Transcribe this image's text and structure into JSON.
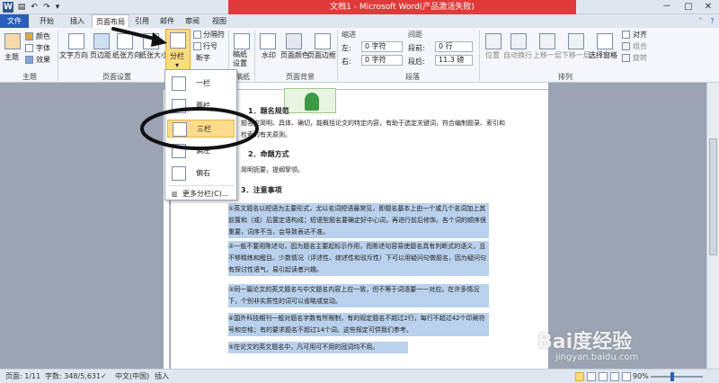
{
  "window": {
    "title": "文档1 - Microsoft Word(产品激活失败)",
    "logo_letter": "W",
    "quick_access": [
      "save-icon",
      "undo-icon",
      "redo-icon"
    ],
    "controls": [
      "－",
      "□",
      "✕"
    ]
  },
  "tabs": [
    {
      "label": "文件",
      "type": "file"
    },
    {
      "label": "开始"
    },
    {
      "label": "插入"
    },
    {
      "label": "页面布局",
      "active": true
    },
    {
      "label": "引用"
    },
    {
      "label": "邮件"
    },
    {
      "label": "审阅"
    },
    {
      "label": "视图"
    }
  ],
  "ribbon": {
    "theme_group": {
      "label": "主题",
      "theme": "主题",
      "colors": "颜色",
      "fonts": "字体",
      "effects": "效果"
    },
    "page_setup": {
      "label": "页面设置",
      "text_direction": "文字方向",
      "margins": "页边距",
      "orientation": "纸张方向",
      "size": "纸张大小",
      "columns": "分栏",
      "breaks": "分隔符",
      "line_numbers": "行号",
      "hyphenation": "断字"
    },
    "draft": {
      "label": "稿纸",
      "button": "稿纸设置"
    },
    "background": {
      "label": "页面背景",
      "watermark": "水印",
      "page_color": "页面颜色",
      "page_border": "页面边框"
    },
    "paragraph": {
      "label": "段落",
      "indent_title": "缩进",
      "spacing_title": "间距",
      "indent_left_label": "左:",
      "indent_left": "0 字符",
      "indent_right_label": "右:",
      "indent_right": "0 字符",
      "spacing_before_label": "段前:",
      "spacing_before": "0 行",
      "spacing_after_label": "段后:",
      "spacing_after": "11.3 磅"
    },
    "arrange": {
      "label": "排列",
      "position": "位置",
      "wrap": "自动换行",
      "forward": "上移一层",
      "backward": "下移一层",
      "selection_pane": "选择窗格",
      "align": "对齐",
      "group": "组合",
      "rotate": "旋转"
    }
  },
  "columns_menu": {
    "items": [
      {
        "label": "一栏"
      },
      {
        "label": "两栏"
      },
      {
        "label": "三栏",
        "selected": true
      },
      {
        "label": "偏左"
      },
      {
        "label": "偏右"
      }
    ],
    "more": "更多分栏(C)..."
  },
  "document": {
    "h1": "1．题名规范",
    "p1": "题名应简明、具体、确切，能概括论文的特定内容，有助于选定关键词，符合编制题录、索引和检索的有关原则。",
    "h2": "2．命题方式",
    "p2": "简明扼要，提纲挈领。",
    "h3": "3．注意事项",
    "items": [
      "①英文题名以短语为主要形式，尤以名词短语最常见，即题名基本上由一个或几个名词加上其前置和（或）后置定语构成；短语型题名要确定好中心词，再进行前后修饰。各个词的顺序很重要，词序不当，会导致表达不准。",
      "②一般不要用陈述句，因为题名主要起标示作用，而陈述句容易使题名具有判断式的语义，且不够精练和醒目。少数情况（评述性、综述性和驳斥性）下可以用疑问句做题名，因为疑问句有探讨性语气，易引起读者兴趣。",
      "③同一篇论文的英文题名与中文题名内容上应一致，但不等于词语要一一对应。在许多情况下，个别非实质性的词可以省略或变动。",
      "④国外科技期刊一般对题名字数有所限制，有的规定题名不超过2行，每行不超过42个印刷符号和空格；有的要求题名不超过14个词。这些规定可供我们参考。",
      "⑤在论文的英文题名中，凡可用可不用的冠词均不用。"
    ]
  },
  "status": {
    "page": "页面: 1/11",
    "words": "字数: 348/5,631",
    "language": "中文(中国)",
    "mode": "插入",
    "zoom": "90%",
    "zoom_level": 0.42
  },
  "watermark": {
    "logo": "Bai度经验",
    "url": "jingyan.baidu.com"
  },
  "colors": {
    "title_bar": "#e03a3a",
    "file_tab": "#2a5eb8",
    "highlight": "#b9d1ec",
    "selected": "#fcdc8a"
  }
}
